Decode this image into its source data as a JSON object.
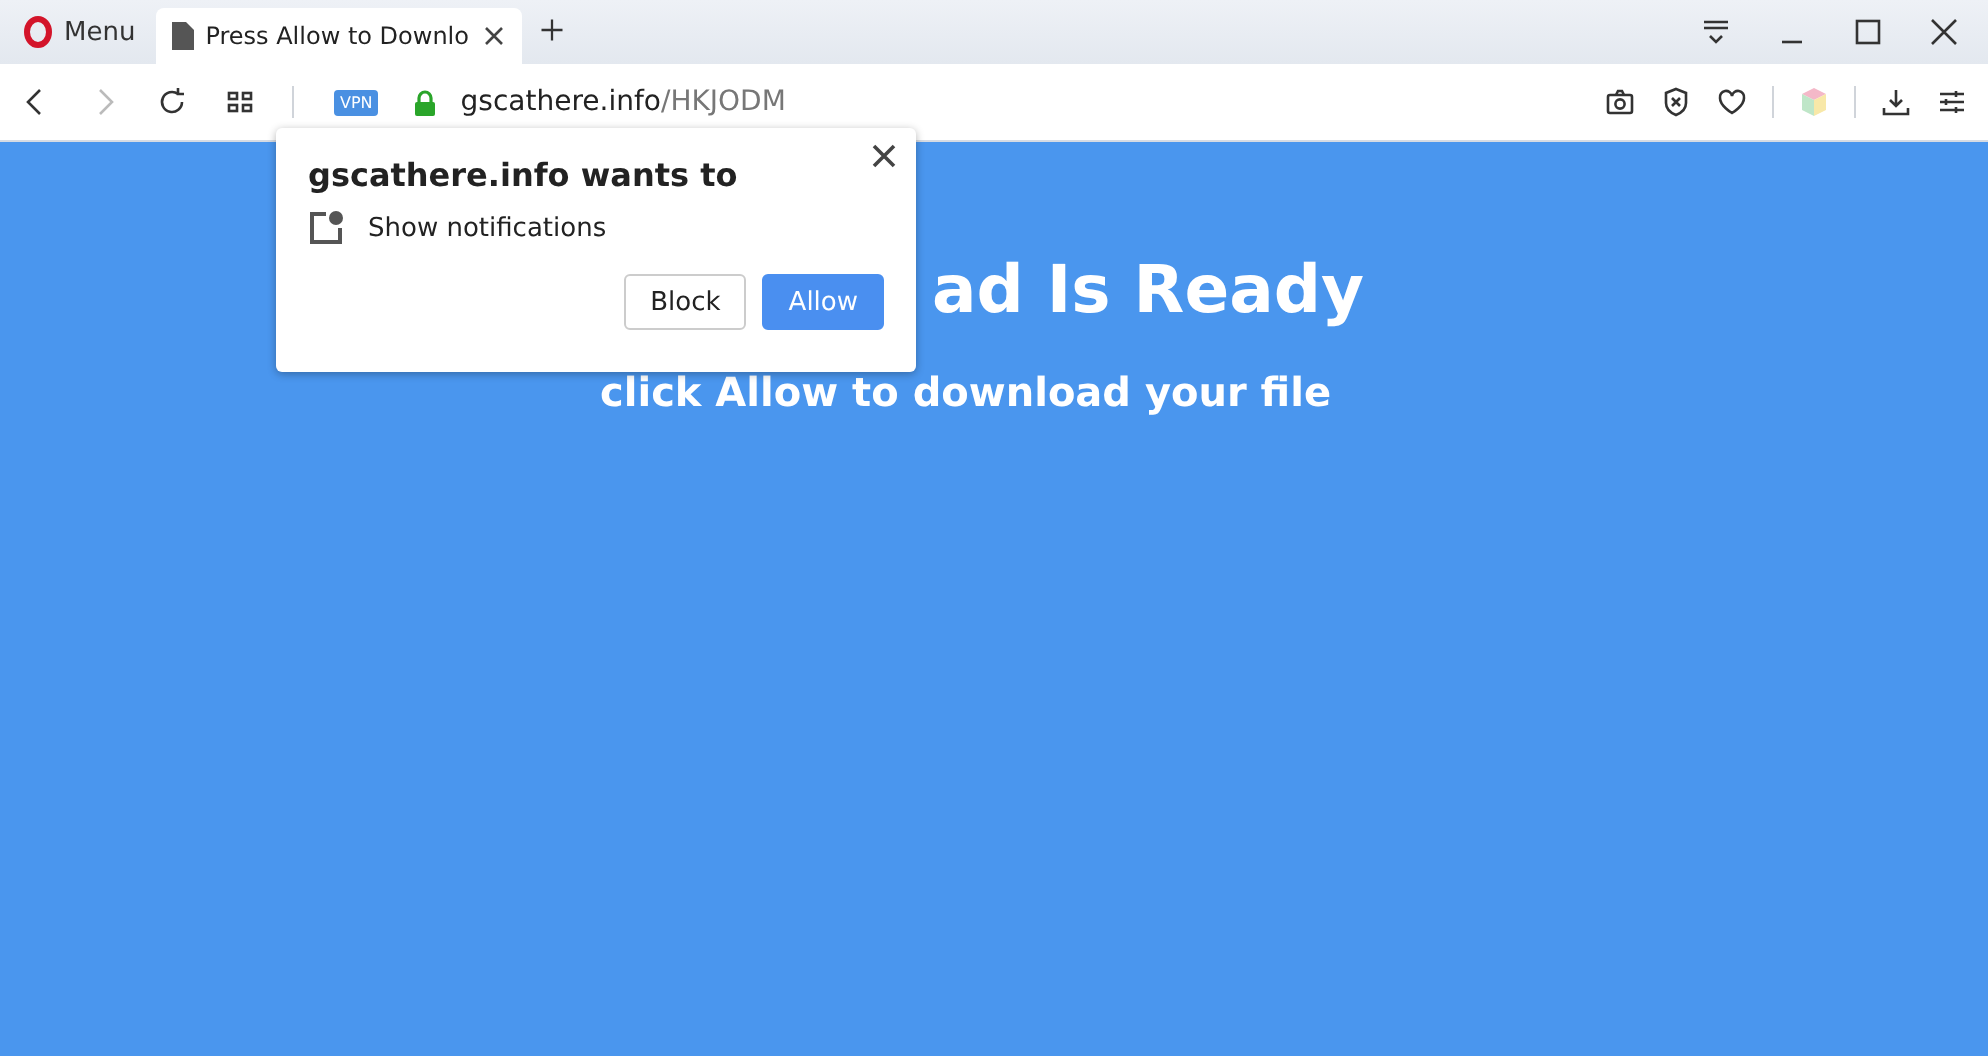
{
  "browser": {
    "menu_label": "Menu",
    "tabs": [
      {
        "title": "Press Allow to Downlo",
        "selected": true
      }
    ],
    "address": {
      "vpn_badge": "VPN",
      "host": "gscathere.info",
      "path": "/HKJODM"
    }
  },
  "page": {
    "headline": "ad Is Ready",
    "subheadline": "click Allow to download your file"
  },
  "permission_popup": {
    "title": "gscathere.info wants to",
    "permission": "Show notifications",
    "buttons": [
      {
        "label": "Block",
        "kind": "secondary"
      },
      {
        "label": "Allow",
        "kind": "primary"
      }
    ]
  }
}
